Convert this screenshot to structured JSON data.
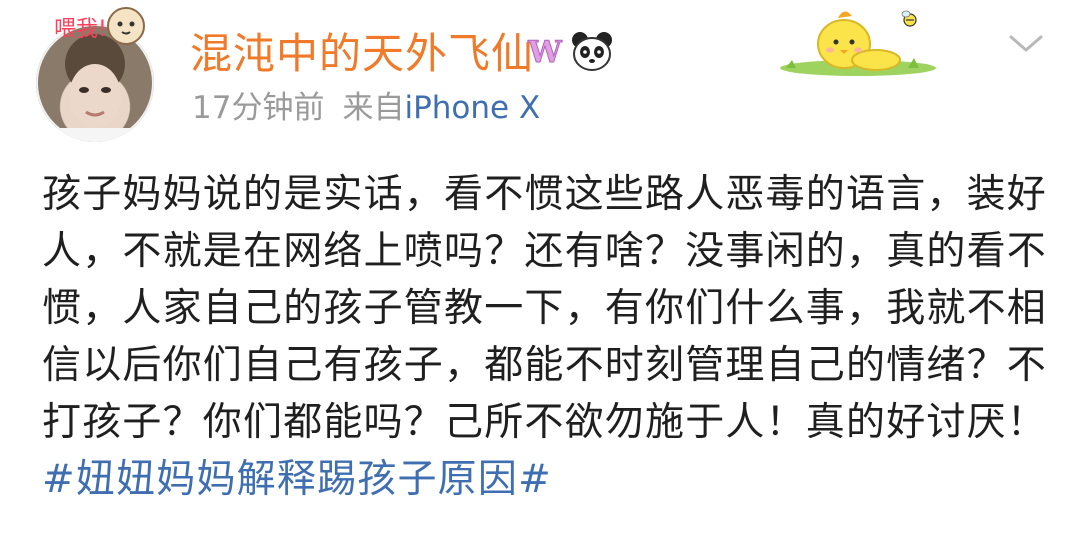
{
  "post": {
    "author": {
      "name": "混沌中的天外飞仙",
      "avatar_sticker_text": "喂我!"
    },
    "time": "17分钟前",
    "source_prefix": "来自",
    "device": "iPhone X",
    "body_text": "孩子妈妈说的是实话，看不惯这些路人恶毒的语言，装好人，不就是在网络上喷吗？还有啥？没事闲的，真的看不惯，人家自己的孩子管教一下，有你们什么事，我就不相信以后你们自己有孩子，都能不时刻管理自己的情绪？不打孩子？你们都能吗？己所不欲勿施于人！真的好讨厌！",
    "hashtag": "#妞妞妈妈解释踢孩子原因#"
  },
  "icons": {
    "vip_badge": "weibo-w-badge-icon",
    "panda_badge": "panda-icon",
    "decoration": "chick-lying-on-grass",
    "menu": "chevron-down-icon"
  },
  "colors": {
    "name": "#f07a2a",
    "link": "#3f6fb0",
    "meta": "#9a9a9a",
    "text": "#1f1f1f"
  }
}
